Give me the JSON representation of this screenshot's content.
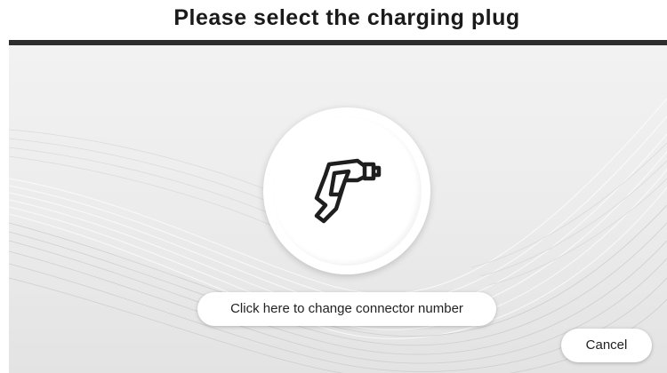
{
  "header": {
    "title": "Please select the charging plug"
  },
  "main": {
    "plug_icon": "ev-charging-plug-icon",
    "connector_button_label": "Click here to change connector number",
    "cancel_label": "Cancel"
  },
  "colors": {
    "divider": "#2d2d2d",
    "background": "#ececec",
    "button_background": "#ffffff",
    "text": "#222222"
  }
}
